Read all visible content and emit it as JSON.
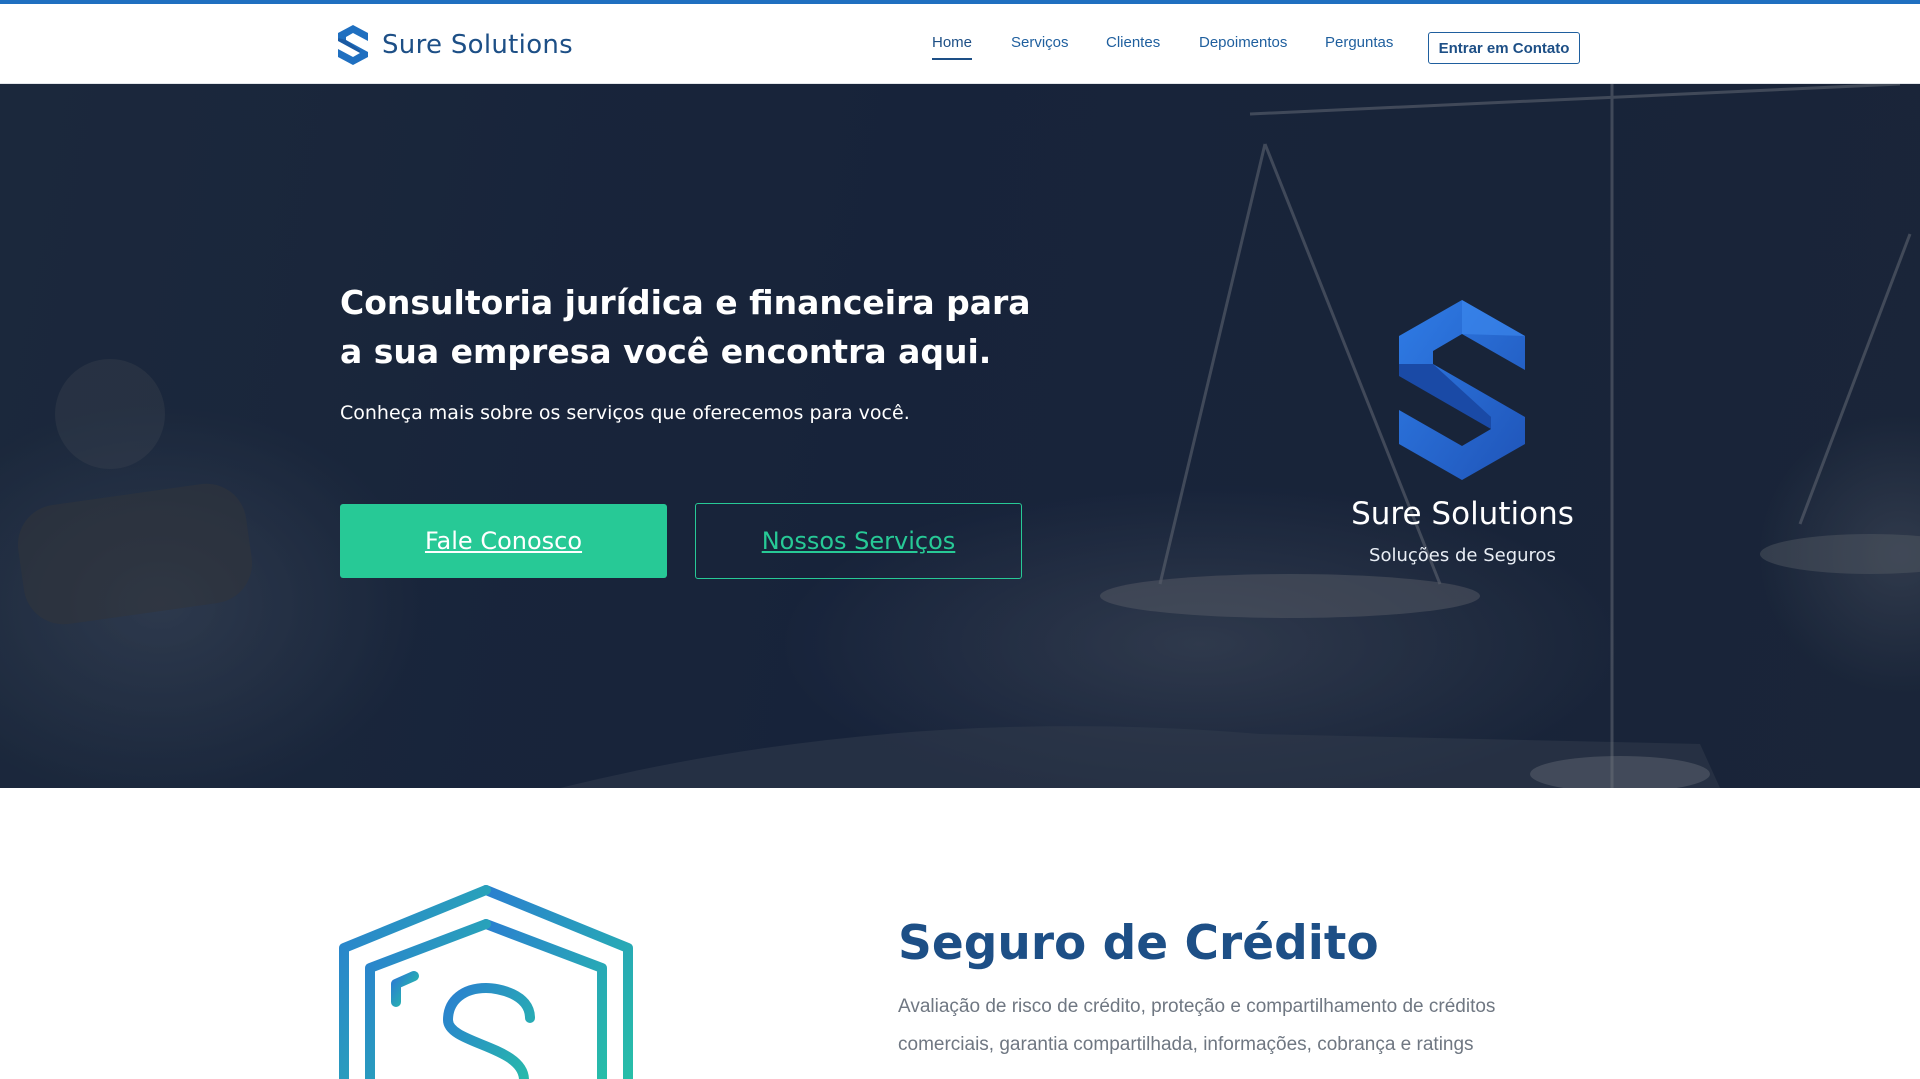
{
  "colors": {
    "brand_blue": "#1d4f86",
    "accent_green": "#27c996",
    "hero_overlay": "#17233a"
  },
  "header": {
    "brand_name": "Sure Solutions",
    "logo_icon": "s-logo-icon",
    "nav": [
      {
        "label": "Home",
        "active": true
      },
      {
        "label": "Serviços",
        "active": false
      },
      {
        "label": "Clientes",
        "active": false
      },
      {
        "label": "Depoimentos",
        "active": false
      },
      {
        "label": "Perguntas",
        "active": false
      }
    ],
    "contact_button": "Entrar em Contato"
  },
  "hero": {
    "title": "Consultoria jurídica e financeira para a sua empresa você encontra aqui.",
    "subtitle": "Conheça mais sobre os serviços que oferecemos para você.",
    "primary_button": "Fale Conosco",
    "secondary_button": "Nossos Serviços",
    "logo_name": "Sure Solutions",
    "logo_tagline": "Soluções de Seguros",
    "background_image": "scales-of-justice-and-gavel"
  },
  "service": {
    "icon": "shield-dollar-icon",
    "title": "Seguro de Crédito",
    "description": "Avaliação de risco de crédito, proteção e compartilhamento de créditos comerciais, garantia compartilhada, informações, cobrança e ratings"
  }
}
